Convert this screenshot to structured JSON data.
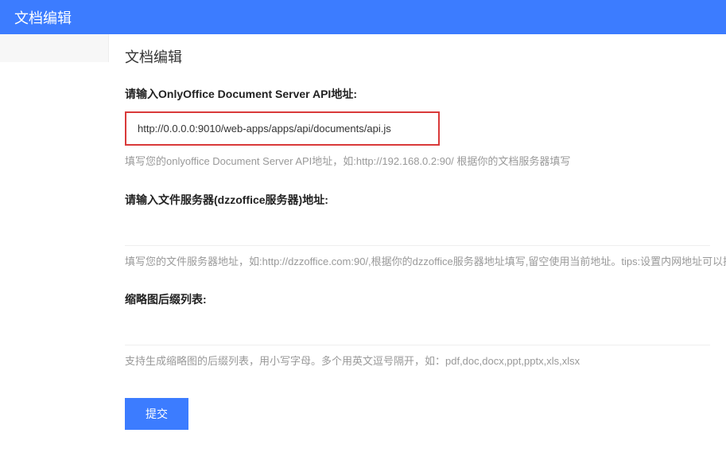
{
  "header": {
    "title": "文档编辑"
  },
  "page": {
    "title": "文档编辑"
  },
  "fields": {
    "api_url": {
      "label": "请输入OnlyOffice Document Server API地址:",
      "value": "http://0.0.0.0:9010/web-apps/apps/api/documents/api.js",
      "help": "填写您的onlyoffice Document Server API地址，如:http://192.168.0.2:90/ 根据你的文档服务器填写"
    },
    "file_server": {
      "label": "请输入文件服务器(dzzoffice服务器)地址:",
      "value": "",
      "help": "填写您的文件服务器地址，如:http://dzzoffice.com:90/,根据你的dzzoffice服务器地址填写,留空使用当前地址。tips:设置内网地址可以提高文件"
    },
    "thumbnail": {
      "label": "缩略图后缀列表:",
      "value": "",
      "help": "支持生成缩略图的后缀列表，用小写字母。多个用英文逗号隔开，如：pdf,doc,docx,ppt,pptx,xls,xlsx"
    }
  },
  "buttons": {
    "submit": "提交"
  }
}
